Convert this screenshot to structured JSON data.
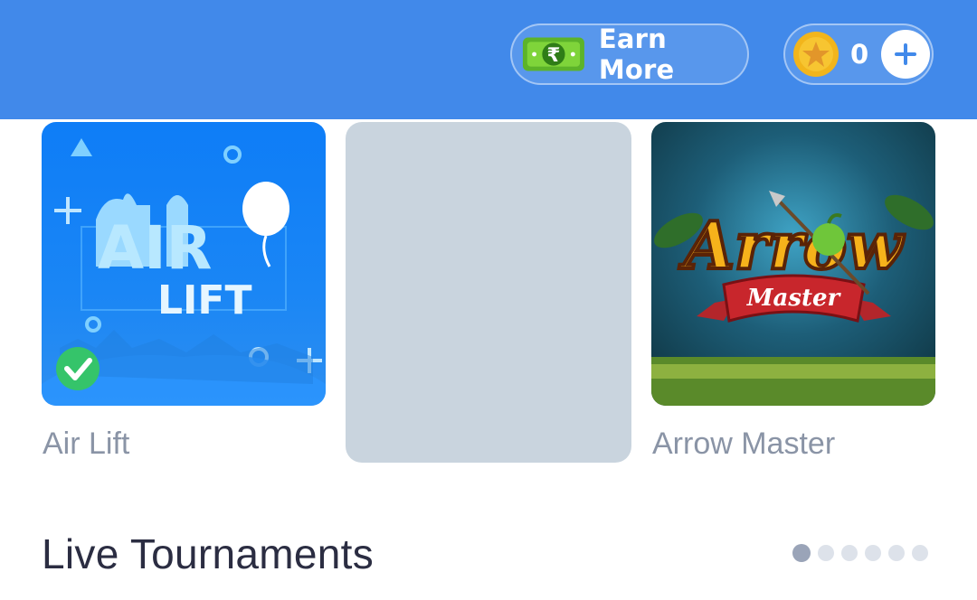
{
  "header": {
    "earn_more_label": "Earn More",
    "coin_count": "0",
    "money_icon": "rupee-note-icon",
    "coin_icon": "star-coin-icon",
    "add_icon": "plus-icon"
  },
  "games": [
    {
      "label": "Air Lift",
      "artwork_text": [
        "AIR",
        "LIFT"
      ],
      "installed": true
    },
    {
      "label": ""
    },
    {
      "label": "Arrow Master",
      "artwork_text": [
        "Arrow",
        "Master"
      ]
    }
  ],
  "section": {
    "title": "Live Tournaments",
    "carousel_active_index": 1,
    "carousel_count": 6
  },
  "colors": {
    "header_bg": "#4189ea",
    "coin_gold": "#f2b51c",
    "check_green": "#35c46a",
    "label_gray": "#8a94a6",
    "title_dark": "#2b2d42"
  }
}
